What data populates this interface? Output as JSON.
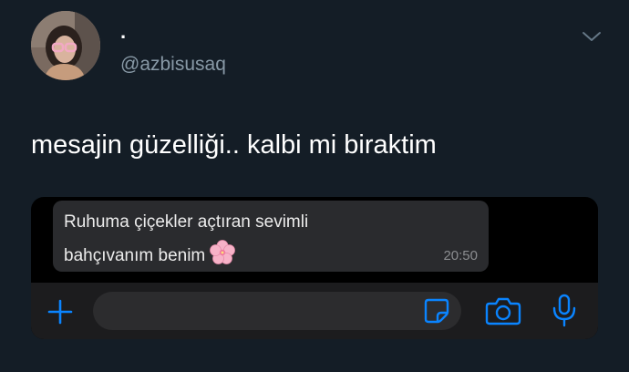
{
  "tweet": {
    "display_name": ".",
    "handle": "@azbisusaq",
    "text": "mesajin güzelliği.. kalbi mi biraktim",
    "avatar_icon": "profile-photo",
    "menu_icon": "chevron-down-icon"
  },
  "chat": {
    "message_line1": "Ruhuma çiçekler açtıran sevimli",
    "message_line2": "bahçıvanım benim",
    "emoji": "cherry-blossom",
    "time": "20:50",
    "input_placeholder": "",
    "accent_color": "#0a84ff",
    "icons": [
      "plus-icon",
      "sticker-icon",
      "camera-icon",
      "microphone-icon"
    ]
  },
  "colors": {
    "background": "#141d26",
    "handle": "#8899a6",
    "bubble": "#2a2b2e",
    "accent": "#0a84ff"
  }
}
